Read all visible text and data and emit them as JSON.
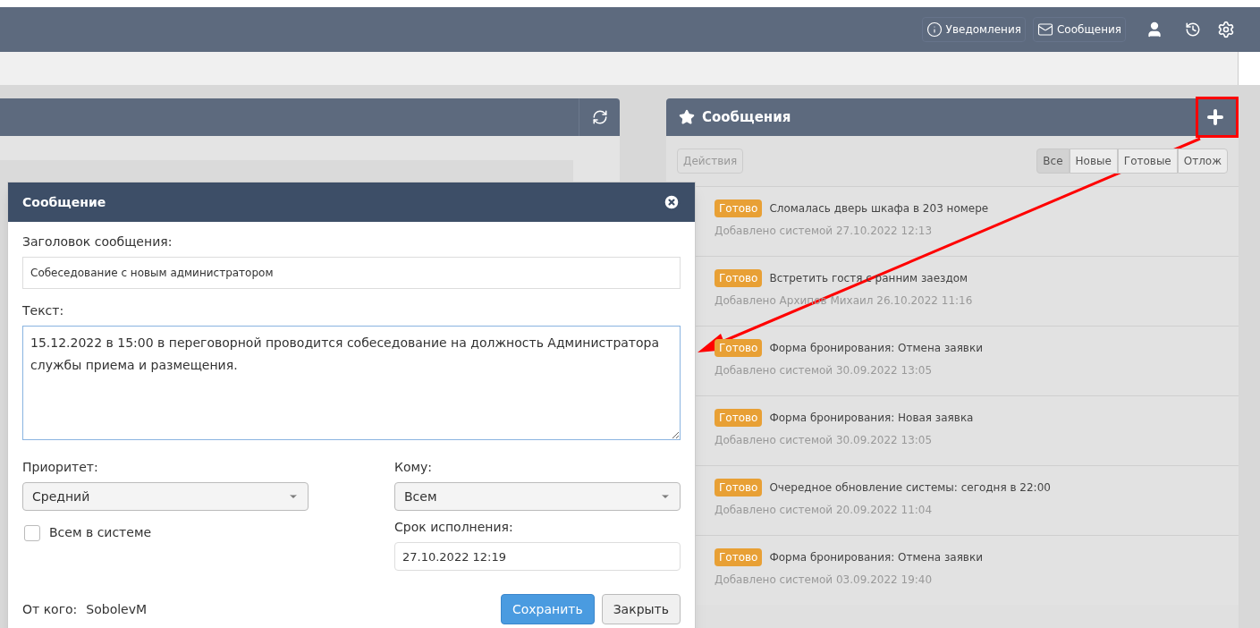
{
  "top_bar": {
    "buttons": [
      "Уведомления",
      "Сообщения"
    ]
  },
  "messages_panel": {
    "title": "Сообщения",
    "actions_button": "Действия",
    "filters": [
      {
        "label": "Все",
        "selected": true
      },
      {
        "label": "Новые",
        "selected": false
      },
      {
        "label": "Готовые",
        "selected": false
      },
      {
        "label": "Отлож",
        "selected": false
      }
    ],
    "items": [
      {
        "status": "Готово",
        "title": "Сломалась дверь шкафа в 203 номере",
        "meta": "Добавлено системой 27.10.2022 12:13"
      },
      {
        "status": "Готово",
        "title": "Встретить гостя с ранним заездом",
        "meta": "Добавлено Архипов Михаил 26.10.2022 11:16"
      },
      {
        "status": "Готово",
        "title": "Форма бронирования: Отмена заявки",
        "meta": "Добавлено системой 30.09.2022 13:05"
      },
      {
        "status": "Готово",
        "title": "Форма бронирования: Новая заявка",
        "meta": "Добавлено системой 30.09.2022 13:05"
      },
      {
        "status": "Готово",
        "title": "Очередное обновление системы: сегодня в 22:00",
        "meta": "Добавлено системой 20.09.2022 11:04"
      },
      {
        "status": "Готово",
        "title": "Форма бронирования: Отмена заявки",
        "meta": "Добавлено системой 03.09.2022 19:40"
      }
    ]
  },
  "dialog": {
    "title": "Сообщение",
    "subject_label": "Заголовок сообщения:",
    "subject": "Собеседование с новым администратором",
    "text_label": "Текст:",
    "text": "15.12.2022 в 15:00 в переговорной проводится собеседование на должность Администратора службы приема и размещения.",
    "priority_label": "Приоритет:",
    "priority": "Средний",
    "to_label": "Кому:",
    "to": "Всем",
    "all_in_system": {
      "label": "Всем в системе",
      "checked": false
    },
    "due_label": "Срок исполнения:",
    "due": "27.10.2022 12:19",
    "from_label": "От кого:",
    "from": "SobolevM",
    "buttons": [
      {
        "label": "Сохранить",
        "kind": "primary"
      },
      {
        "label": "Закрыть",
        "kind": "default"
      }
    ]
  }
}
